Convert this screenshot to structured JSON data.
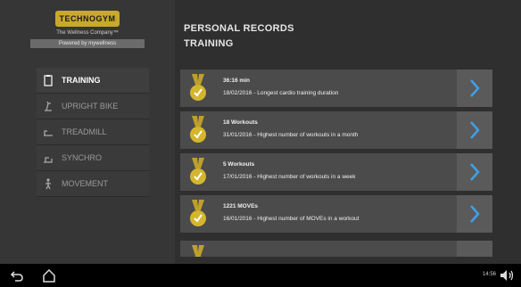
{
  "brand": {
    "logo_text": "TECHNOGYM",
    "tagline": "The Wellness Company™",
    "powered": "Powered by mywellness"
  },
  "header": {
    "title": "PERSONAL RECORDS",
    "subtitle": "TRAINING"
  },
  "sidebar": {
    "items": [
      {
        "label": "TRAINING",
        "icon": "clipboard-icon",
        "active": true
      },
      {
        "label": "UPRIGHT BIKE",
        "icon": "upright-bike-icon",
        "active": false
      },
      {
        "label": "TREADMILL",
        "icon": "treadmill-icon",
        "active": false
      },
      {
        "label": "SYNCHRO",
        "icon": "synchro-icon",
        "active": false
      },
      {
        "label": "MOVEMENT",
        "icon": "movement-icon",
        "active": false
      }
    ]
  },
  "records": [
    {
      "value": "36:16 min",
      "description": "18/02/2016 - Longest cardio training duration"
    },
    {
      "value": "18 Workouts",
      "description": "31/01/2016 - Highest number of workouts in a month"
    },
    {
      "value": "5 Workouts",
      "description": "17/01/2016 - Highest number of workouts in a week"
    },
    {
      "value": "1221 MOVEs",
      "description": "16/01/2016 - Highest number of MOVEs in a workout"
    }
  ],
  "system": {
    "time": "14:56",
    "back_icon": "back-icon",
    "home_icon": "home-icon",
    "volume_icon": "volume-icon"
  },
  "colors": {
    "accent_gold": "#d4b62e",
    "chevron_blue": "#3fa0e6",
    "card_bg": "#4b4b4b"
  }
}
